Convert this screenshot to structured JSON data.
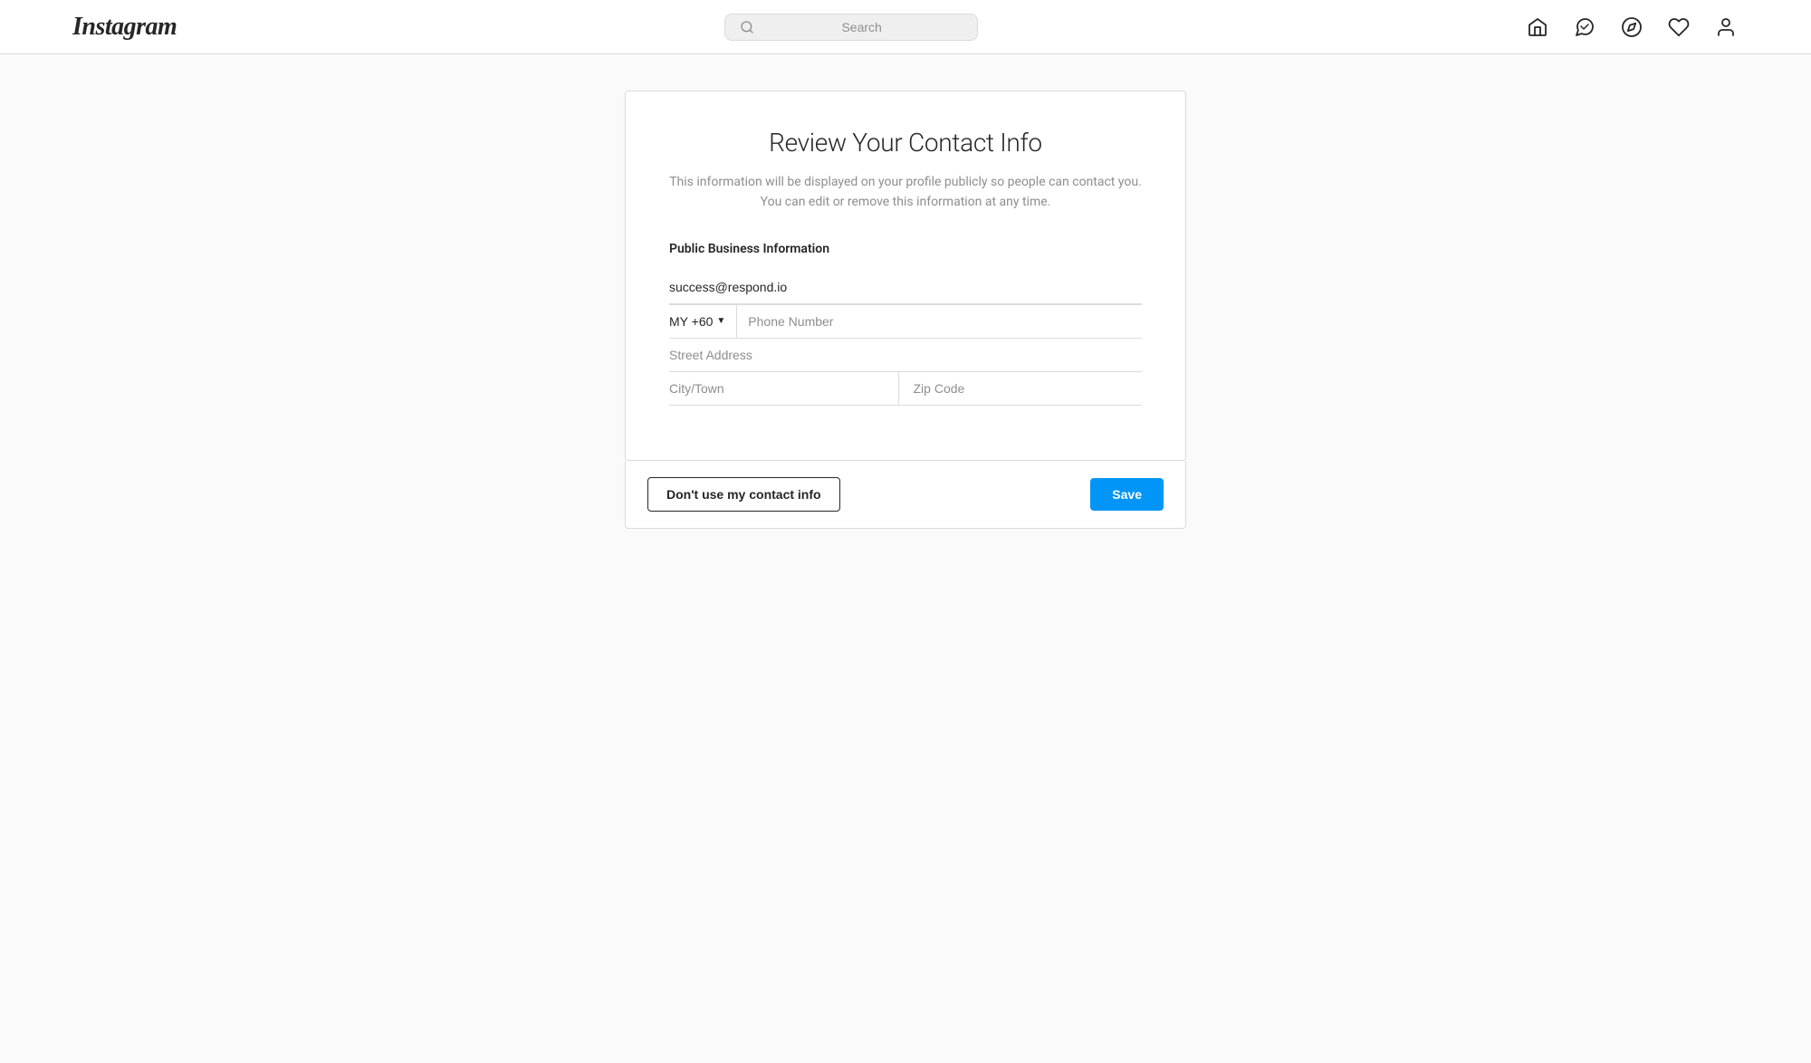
{
  "brand": {
    "logo": "Instagram"
  },
  "navbar": {
    "search_placeholder": "Search"
  },
  "page": {
    "title": "Review Your Contact Info",
    "subtitle_line1": "This information will be displayed on your profile publicly so people can contact you.",
    "subtitle_line2": "You can edit or remove this information at any time.",
    "section_title": "Public Business Information",
    "fields": {
      "email_value": "success@respond.io",
      "phone_country": "MY +60",
      "phone_placeholder": "Phone Number",
      "street_placeholder": "Street Address",
      "city_placeholder": "City/Town",
      "zip_placeholder": "Zip Code"
    },
    "buttons": {
      "dont_use": "Don't use my contact info",
      "save": "Save"
    }
  }
}
